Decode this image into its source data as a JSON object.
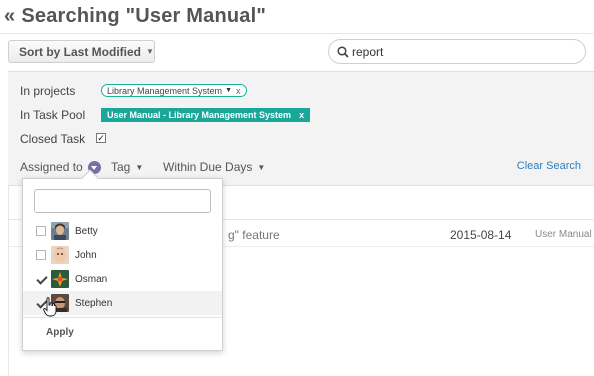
{
  "header": {
    "back_symbol": "«",
    "title": "Searching \"User Manual\""
  },
  "toolbar": {
    "sort_label": "Sort by Last Modified",
    "search_icon": "search-icon",
    "search_value": "report"
  },
  "filters": {
    "projects_label": "In projects",
    "project_tag": "Library Management System",
    "project_tag_remove": "x",
    "task_pool_label": "In Task Pool",
    "task_pool_tag": "User Manual - Library Management System",
    "task_pool_tag_remove": "x",
    "closed_task_label": "Closed Task",
    "closed_task_checked": true,
    "assigned_to_label": "Assigned to",
    "tag_label": "Tag",
    "due_days_label": "Within Due Days",
    "clear_search": "Clear Search",
    "accent_color": "#1aa79a"
  },
  "results": {
    "rows": [
      {
        "title_fragment": "g\" feature",
        "date": "2015-08-14",
        "pool": "User Manual"
      }
    ]
  },
  "assignee_dropdown": {
    "search_value": "",
    "users": [
      {
        "name": "Betty",
        "checked": false
      },
      {
        "name": "John",
        "checked": false
      },
      {
        "name": "Osman",
        "checked": true
      },
      {
        "name": "Stephen",
        "checked": true
      }
    ],
    "apply_label": "Apply"
  }
}
